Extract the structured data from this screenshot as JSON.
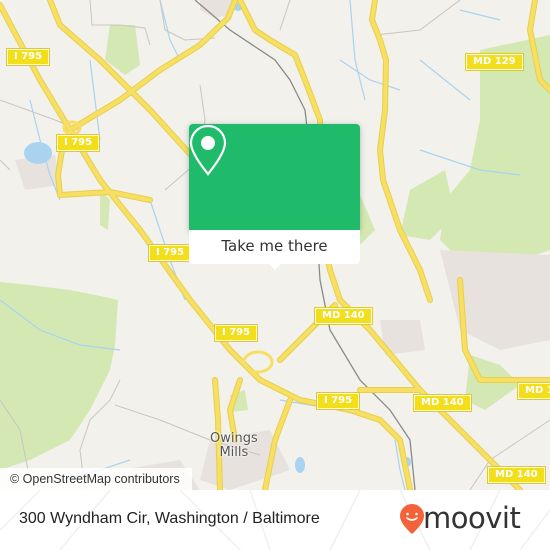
{
  "map": {
    "colors": {
      "land": "#f2f1ec",
      "forest": "#d4e8b3",
      "water": "#aad3f0",
      "road_major": "#f6df62",
      "road_major_casing": "#e8cf4c",
      "road_minor": "#c9c6c0",
      "rail": "#8a8a8a",
      "urban": "#e8e2de"
    },
    "road_shields": [
      {
        "label": "I 795"
      },
      {
        "label": "I 795"
      },
      {
        "label": "I 795"
      },
      {
        "label": "I 795"
      },
      {
        "label": "I 795"
      },
      {
        "label": "MD 129"
      },
      {
        "label": "MD 140"
      },
      {
        "label": "MD 140"
      },
      {
        "label": "MD 140"
      },
      {
        "label": "MD 1"
      }
    ],
    "place_labels": [
      {
        "line1": "Owings",
        "line2": "Mills"
      }
    ],
    "attribution": "© OpenStreetMap contributors"
  },
  "popup": {
    "button_label": "Take me there",
    "header_color": "#1fba6a",
    "icon": "map-pin-icon"
  },
  "footer": {
    "address": "300 Wyndham Cir, Washington / Baltimore",
    "brand": {
      "name": "moovit",
      "icon": "moovit-logo-pin-icon",
      "color": "#f4623a"
    }
  }
}
